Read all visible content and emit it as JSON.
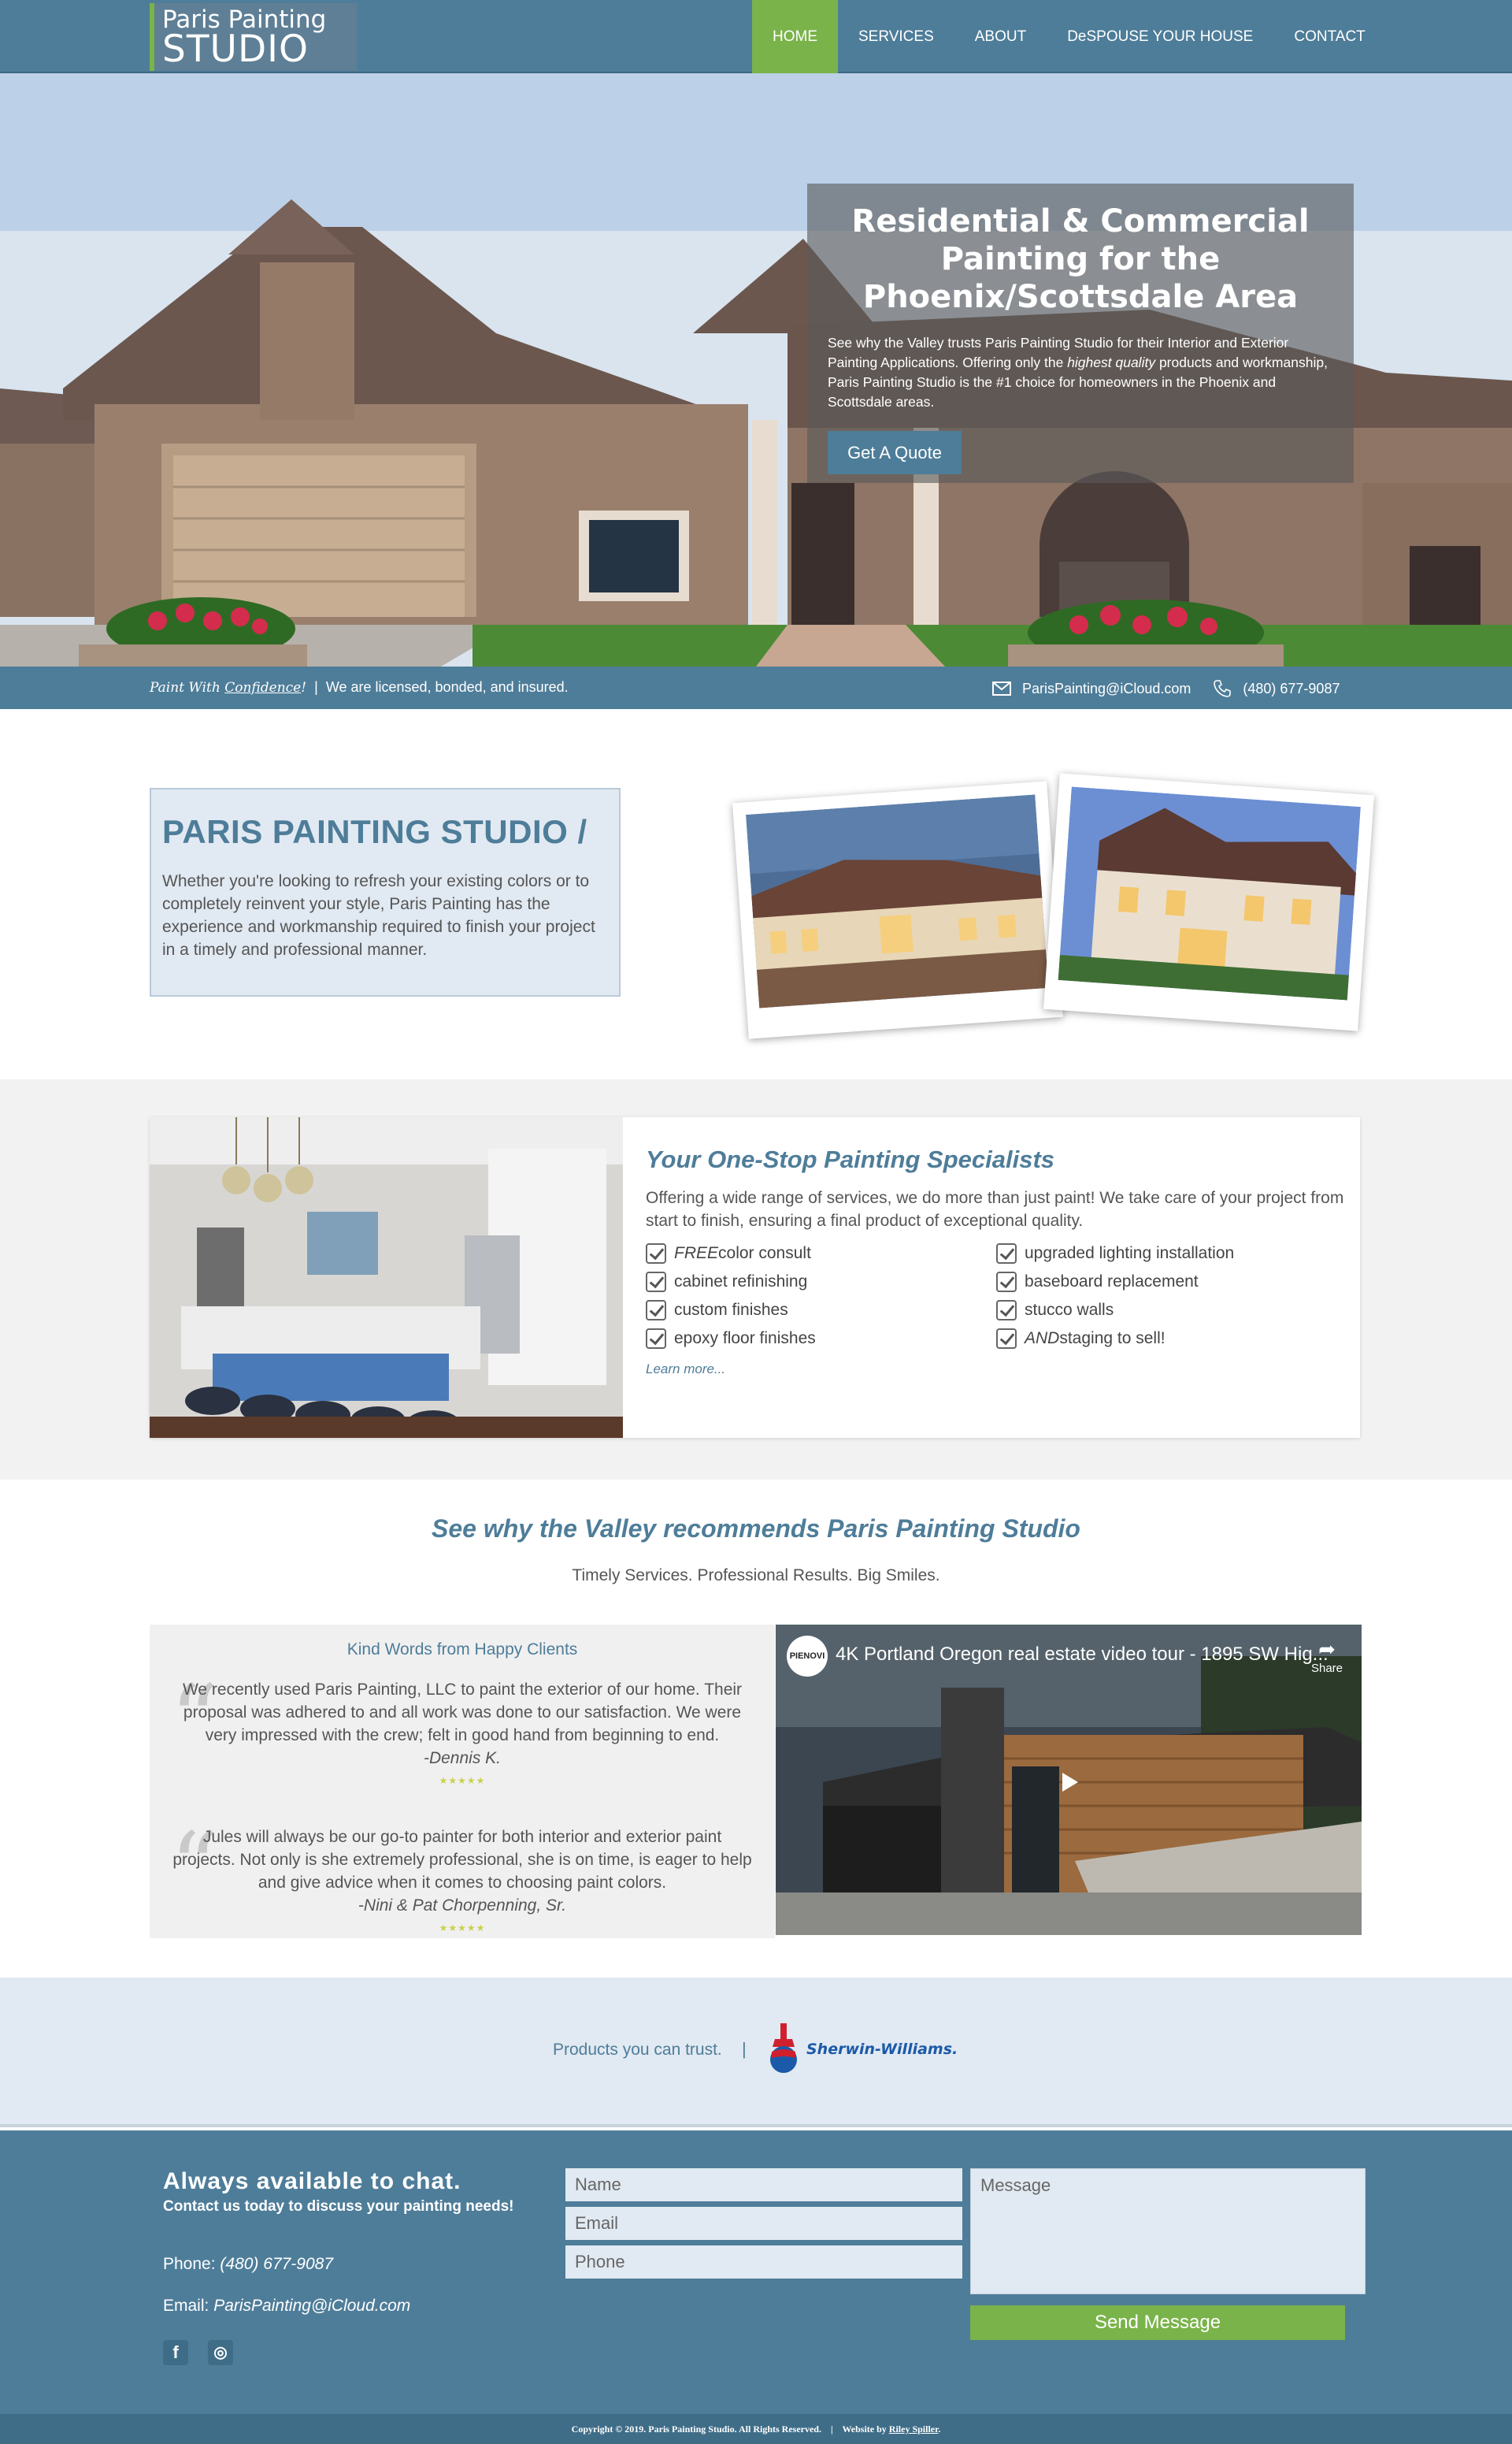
{
  "brand": {
    "line1": "Paris Painting",
    "line2": "STUDIO"
  },
  "nav": {
    "items": [
      {
        "label": "HOME",
        "active": true
      },
      {
        "label": "SERVICES",
        "active": false
      },
      {
        "label": "ABOUT",
        "active": false
      },
      {
        "label": "DeSPOUSE YOUR HOUSE",
        "active": false
      },
      {
        "label": "CONTACT",
        "active": false
      }
    ]
  },
  "hero": {
    "title": "Residential & Commercial Painting for the Phoenix/Scottsdale Area",
    "body_before": "See why the Valley trusts Paris Painting Studio for their Interior and Exterior Painting Applications. Offering only the ",
    "body_emph": "highest quality",
    "body_after": " products and workmanship, Paris Painting Studio is the #1 choice for homeowners in the Phoenix and Scottsdale areas.",
    "cta": "Get A Quote"
  },
  "infobar": {
    "tag_prefix": "Paint With ",
    "tag_underlined": "Confidence",
    "tag_suffix": "!",
    "divider": "|",
    "licensed": "We are licensed, bonded, and insured.",
    "email": "ParisPainting@iCloud.com",
    "phone": "(480) 677-9087"
  },
  "about": {
    "title": "PARIS PAINTING STUDIO /",
    "body": "Whether you're looking to refresh your existing colors or to completely reinvent your style, Paris Painting has the experience and workmanship required to finish your project in a timely and professional manner."
  },
  "services": {
    "title": "Your One-Stop Painting Specialists",
    "intro": "Offering a wide range of services, we do more than just paint! We take care of your project from start to finish, ensuring a final product of exceptional quality.",
    "items": [
      {
        "em": "FREE",
        "text": " color consult"
      },
      {
        "em": "",
        "text": "upgraded lighting installation"
      },
      {
        "em": "",
        "text": "cabinet refinishing"
      },
      {
        "em": "",
        "text": "baseboard replacement"
      },
      {
        "em": "",
        "text": "custom finishes"
      },
      {
        "em": "",
        "text": "stucco walls"
      },
      {
        "em": "",
        "text": "epoxy floor finishes"
      },
      {
        "em": "AND",
        "text": " staging to sell!"
      }
    ],
    "learn_more": "Learn more..."
  },
  "why": {
    "title": "See why the Valley recommends Paris Painting Studio",
    "subtitle": "Timely Services. Professional Results. Big Smiles."
  },
  "testimonials": {
    "heading": "Kind Words from Happy Clients",
    "items": [
      {
        "text": "We recently used Paris Painting, LLC to paint the exterior of our home. Their proposal was adhered to and all work was done to our satisfaction. We were very impressed with the crew; felt in good hand from beginning to end.",
        "author": "-Dennis K.",
        "stars": "★★★★★"
      },
      {
        "text": "Jules will always be our go-to painter for both interior and exterior paint projects. Not only is she extremely professional, she is on time, is eager to help and give advice when it comes to choosing paint colors.",
        "author": "-Nini & Pat Chorpenning, Sr.",
        "stars": "★★★★★"
      }
    ]
  },
  "video": {
    "title": "4K Portland Oregon real estate video tour - 1895 SW Hig...",
    "channel_badge": "PIENOVI",
    "share": "Share"
  },
  "products": {
    "text": "Products you can trust.",
    "divider": "|",
    "brand": "Sherwin-Williams."
  },
  "contact": {
    "heading": "Always available to chat.",
    "subheading": "Contact us today to discuss your painting needs!",
    "phone_label": "Phone: ",
    "phone": "(480) 677-9087",
    "email_label": "Email: ",
    "email": "ParisPainting@iCloud.com",
    "form": {
      "name_placeholder": "Name",
      "email_placeholder": "Email",
      "phone_placeholder": "Phone",
      "message_placeholder": "Message",
      "submit": "Send Message"
    },
    "social": {
      "facebook": "f",
      "instagram": "◎"
    }
  },
  "footer": {
    "copyright": "Copyright © 2019. Paris Painting Studio. All Rights Reserved.",
    "divider": "|",
    "credit_prefix": "Website by ",
    "credit_name": "Riley Spiller",
    "credit_suffix": "."
  },
  "colors": {
    "primary": "#4e7d99",
    "accent": "#7ab34a",
    "light": "#e1e9f2"
  },
  "icons": {
    "email": "envelope-icon",
    "phone": "phone-icon",
    "check": "checkbox-icon",
    "play": "play-icon",
    "share": "share-icon"
  }
}
